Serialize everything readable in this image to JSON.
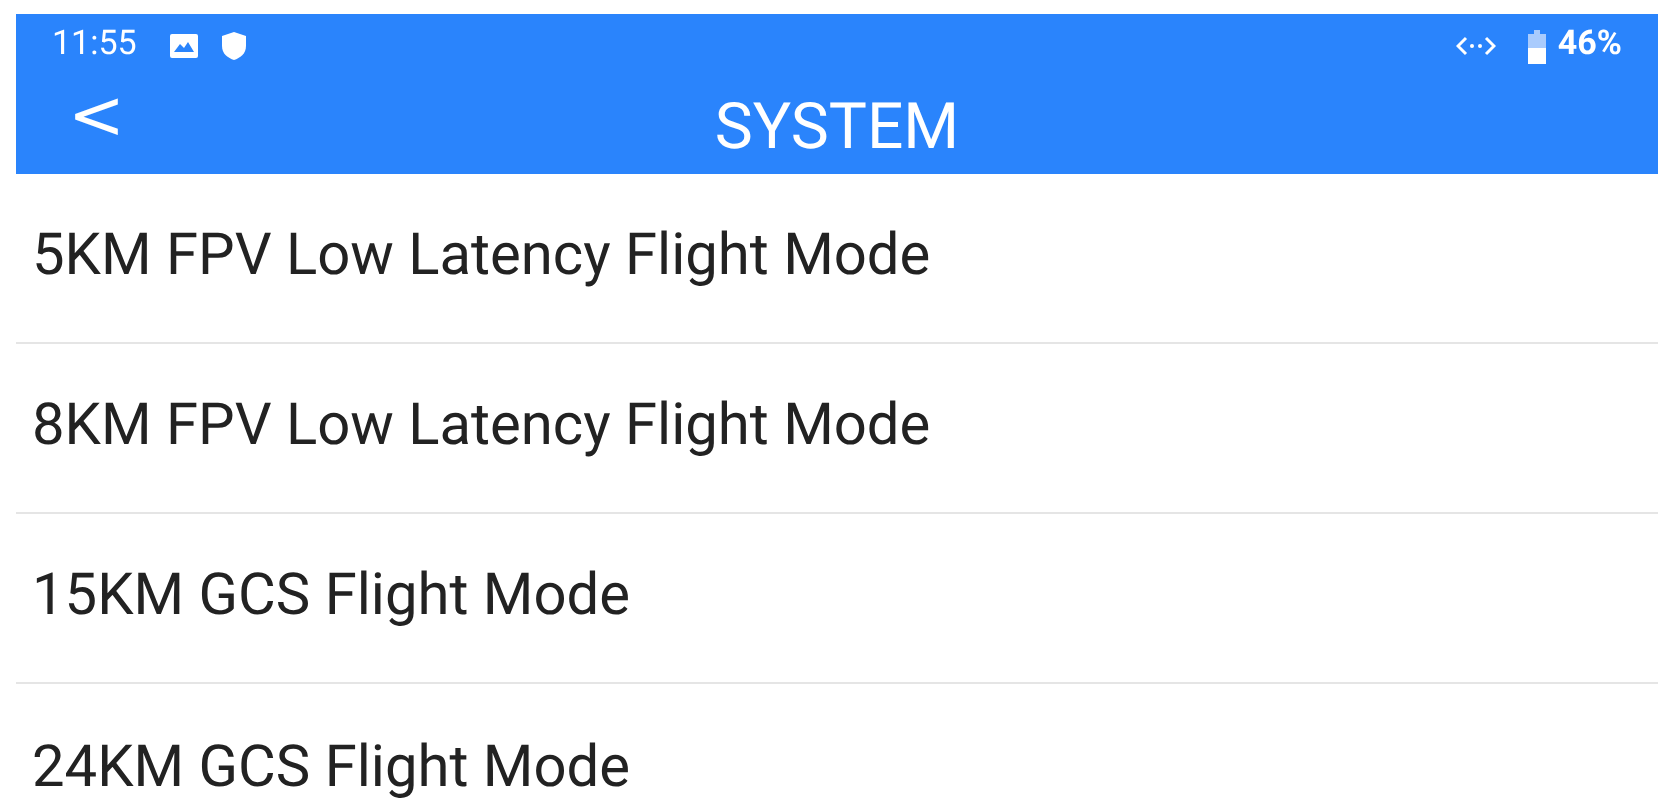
{
  "status_bar": {
    "time": "11:55",
    "battery": "46%"
  },
  "header": {
    "back": "<",
    "title": "SYSTEM"
  },
  "items": [
    {
      "label": "5KM FPV Low Latency Flight Mode"
    },
    {
      "label": "8KM FPV Low Latency Flight Mode"
    },
    {
      "label": "15KM GCS Flight Mode"
    },
    {
      "label": "24KM GCS Flight Mode"
    }
  ]
}
